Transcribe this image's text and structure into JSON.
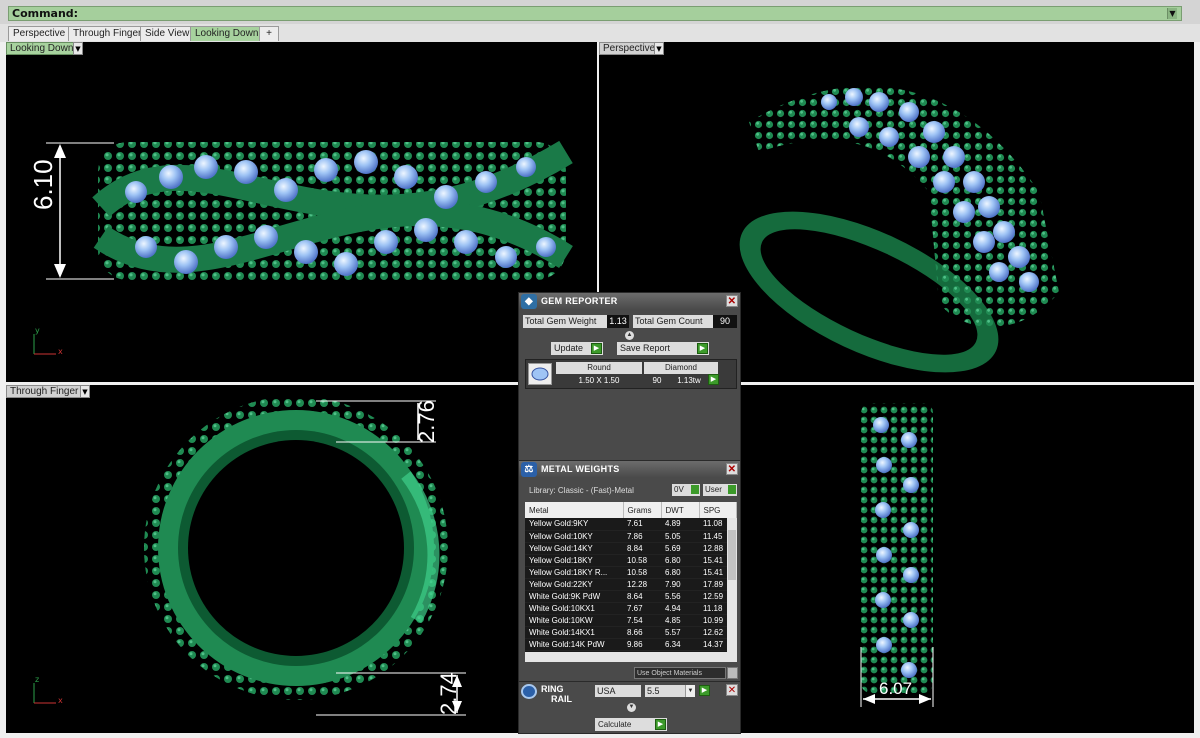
{
  "command": {
    "label": "Command:"
  },
  "tabs": [
    "Perspective",
    "Through Finger",
    "Side View",
    "Looking Down"
  ],
  "add_tab_glyph": "+",
  "viewports": {
    "top_left": {
      "label": "Looking Down",
      "dimension": "6.10",
      "axis_v": "y",
      "axis_h": "x"
    },
    "top_right": {
      "label": "Perspective"
    },
    "bottom_left": {
      "label": "Through Finger",
      "dim_top": "2.76",
      "dim_bottom": "2.74",
      "axis_v": "z",
      "axis_h": "x"
    },
    "bottom_right": {
      "dimension": "6.07"
    }
  },
  "gem_reporter": {
    "title": "GEM REPORTER",
    "total_weight_label": "Total Gem Weight",
    "total_weight_value": "1.13",
    "total_count_label": "Total Gem Count",
    "total_count_value": "90",
    "update_label": "Update",
    "save_label": "Save Report",
    "gem": {
      "shape": "Round",
      "material": "Diamond",
      "size": "1.50 X 1.50",
      "count": "90",
      "weight": "1.13tw"
    }
  },
  "metal_weights": {
    "title": "METAL WEIGHTS",
    "library": "Library: Classic - (Fast)-Metal",
    "vol_label": "0V",
    "user_label": "User",
    "columns": [
      "Metal",
      "Grams",
      "DWT",
      "SPG"
    ],
    "rows": [
      [
        "Yellow Gold:9KY",
        "7.61",
        "4.89",
        "11.08"
      ],
      [
        "Yellow Gold:10KY",
        "7.86",
        "5.05",
        "11.45"
      ],
      [
        "Yellow Gold:14KY",
        "8.84",
        "5.69",
        "12.88"
      ],
      [
        "Yellow Gold:18KY",
        "10.58",
        "6.80",
        "15.41"
      ],
      [
        "Yellow Gold:18KY R...",
        "10.58",
        "6.80",
        "15.41"
      ],
      [
        "Yellow Gold:22KY",
        "12.28",
        "7.90",
        "17.89"
      ],
      [
        "White Gold:9K PdW",
        "8.64",
        "5.56",
        "12.59"
      ],
      [
        "White Gold:10KX1",
        "7.67",
        "4.94",
        "11.18"
      ],
      [
        "White Gold:10KW",
        "7.54",
        "4.85",
        "10.99"
      ],
      [
        "White Gold:14KX1",
        "8.66",
        "5.57",
        "12.62"
      ],
      [
        "White Gold:14K PdW",
        "9.86",
        "6.34",
        "14.37"
      ]
    ],
    "use_object_materials": "Use Object Materials"
  },
  "ring_rail": {
    "title_1": "RING",
    "title_2": "RAIL",
    "region": "USA",
    "size": "5.5",
    "calculate": "Calculate"
  },
  "colors": {
    "metal": "#1f8a52",
    "gem": "#9fc4f5",
    "accent": "#a7d29e"
  }
}
